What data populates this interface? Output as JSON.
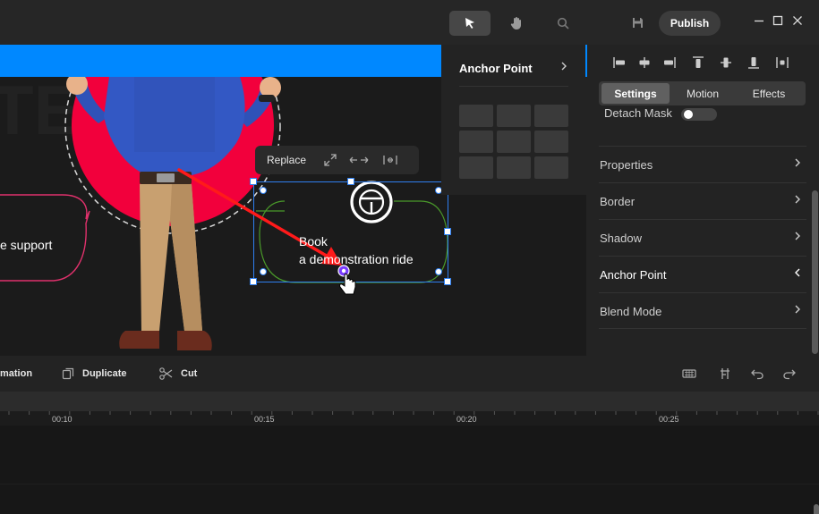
{
  "topbar": {
    "publish_label": "Publish",
    "icons": [
      "cursor-icon",
      "hand-icon",
      "search-icon",
      "save-icon",
      "minimize-icon",
      "maximize-icon",
      "close-icon"
    ]
  },
  "canvas": {
    "speech_bubble_text": "e support",
    "book_button": {
      "line1": "Book",
      "line2": "a demonstration ride"
    },
    "context_toolbar": {
      "replace_label": "Replace",
      "icons": [
        "expand-icon",
        "swap-horizontal-icon",
        "fit-width-icon"
      ]
    },
    "steering_wheel_icon": "steering-wheel-icon",
    "colors": {
      "blue_band": "#0088ff",
      "red_circle": "#f2003c",
      "selection": "#2f7ff0",
      "arrow": "#ff1a1a",
      "anchor_point": "#7a3cff"
    }
  },
  "anchor_popover": {
    "title": "Anchor Point",
    "grid_cells": 9
  },
  "right_panel": {
    "align_icons": [
      "align-left-icon",
      "align-center-h-icon",
      "align-right-icon",
      "align-top-icon",
      "align-middle-v-icon",
      "align-bottom-icon",
      "distribute-icon"
    ],
    "tabs": [
      {
        "label": "Settings",
        "active": true
      },
      {
        "label": "Motion",
        "active": false
      },
      {
        "label": "Effects",
        "active": false
      }
    ],
    "detach_mask_label": "Detach Mask",
    "detach_mask_on": false,
    "sections": [
      {
        "label": "Properties",
        "expanded": false
      },
      {
        "label": "Border",
        "expanded": false
      },
      {
        "label": "Shadow",
        "expanded": false
      },
      {
        "label": "Anchor Point",
        "expanded": true
      },
      {
        "label": "Blend Mode",
        "expanded": false
      }
    ]
  },
  "bottom_toolbar": {
    "animation_label": "mation",
    "duplicate_label": "Duplicate",
    "cut_label": "Cut",
    "right_icons": [
      "keyboard-icon",
      "split-icon",
      "undo-icon",
      "redo-icon"
    ]
  },
  "timeline": {
    "ticks": [
      "00:10",
      "00:15",
      "00:20",
      "00:25"
    ]
  }
}
